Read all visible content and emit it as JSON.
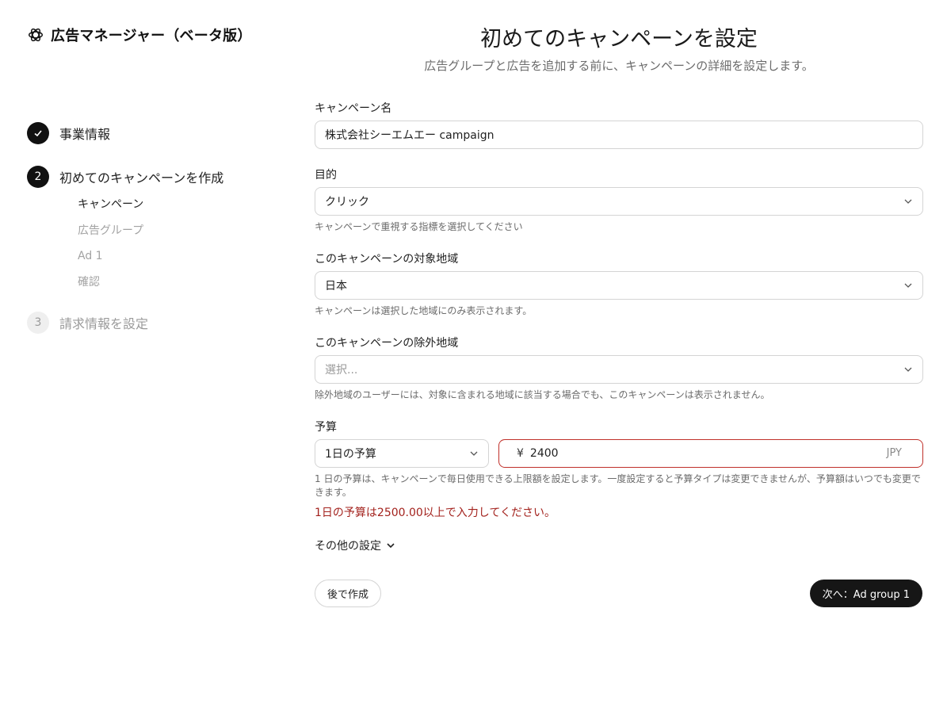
{
  "brand": {
    "title": "広告マネージャー（ベータ版）",
    "icon": "openai-logo-icon"
  },
  "steps": [
    {
      "number": "✓",
      "label": "事業情報",
      "status": "done"
    },
    {
      "number": "2",
      "label": "初めてのキャンペーンを作成",
      "status": "active",
      "substeps": [
        "キャンペーン",
        "広告グループ",
        "Ad 1",
        "確認"
      ]
    },
    {
      "number": "3",
      "label": "請求情報を設定",
      "status": "pending"
    }
  ],
  "header": {
    "title": "初めてのキャンペーンを設定",
    "subtitle": "広告グループと広告を追加する前に、キャンペーンの詳細を設定します。"
  },
  "form": {
    "name": {
      "label": "キャンペーン名",
      "value": "株式会社シーエムエー campaign"
    },
    "goal": {
      "label": "目的",
      "value": "クリック",
      "help": "キャンペーンで重視する指標を選択してください"
    },
    "region": {
      "label": "このキャンペーンの対象地域",
      "value": "日本",
      "help": "キャンペーンは選択した地域にのみ表示されます。"
    },
    "exclude": {
      "label": "このキャンペーンの除外地域",
      "placeholder": "選択...",
      "help": "除外地域のユーザーには、対象に含まれる地域に該当する場合でも、このキャンペーンは表示されません。"
    },
    "budget": {
      "label": "予算",
      "type": "1日の予算",
      "currency_symbol": "¥",
      "amount": "2400",
      "currency": "JPY",
      "help": "1 日の予算は、キャンペーンで毎日使用できる上限額を設定します。一度設定すると予算タイプは変更できませんが、予算額はいつでも変更できます。",
      "error": "1日の予算は2500.00以上で入力してください。"
    },
    "more_settings": "その他の設定"
  },
  "buttons": {
    "later": "後で作成",
    "next": "次へ：Ad group 1"
  },
  "colors": {
    "error": "#a3221d",
    "primary_button": "#161616"
  }
}
